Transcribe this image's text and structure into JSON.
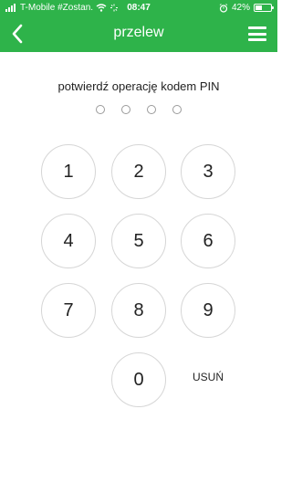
{
  "status_bar": {
    "carrier": "T-Mobile #Zostan.",
    "time": "08:47",
    "battery": "42%"
  },
  "header": {
    "title": "przelew"
  },
  "prompt": "potwierdź operację kodem PIN",
  "keypad": {
    "keys": [
      "1",
      "2",
      "3",
      "4",
      "5",
      "6",
      "7",
      "8",
      "9",
      "0"
    ],
    "delete_label": "USUŃ"
  },
  "colors": {
    "brand_green": "#2eb34a",
    "key_border": "#d6d6d6"
  }
}
